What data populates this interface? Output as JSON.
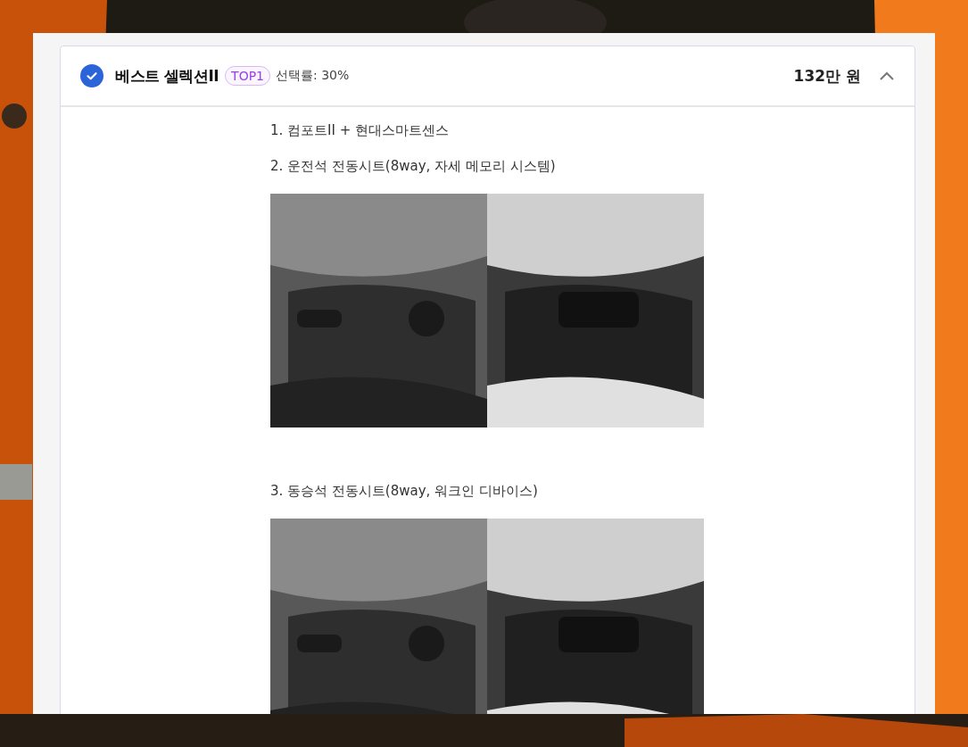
{
  "option": {
    "checked": true,
    "title": "베스트 셀렉션II",
    "badge": "TOP1",
    "rate": "선택률: 30%",
    "price": "132만 원",
    "expanded": true
  },
  "content": [
    {
      "kind": "text",
      "text": "1. 컴포트II + 현대스마트센스"
    },
    {
      "kind": "text",
      "text": "2. 운전석 전동시트(8way, 자세 메모리 시스템)"
    },
    {
      "kind": "photos"
    },
    {
      "kind": "text",
      "text": "3. 동승석 전동시트(8way, 워크인 디바이스)"
    },
    {
      "kind": "photos"
    }
  ]
}
